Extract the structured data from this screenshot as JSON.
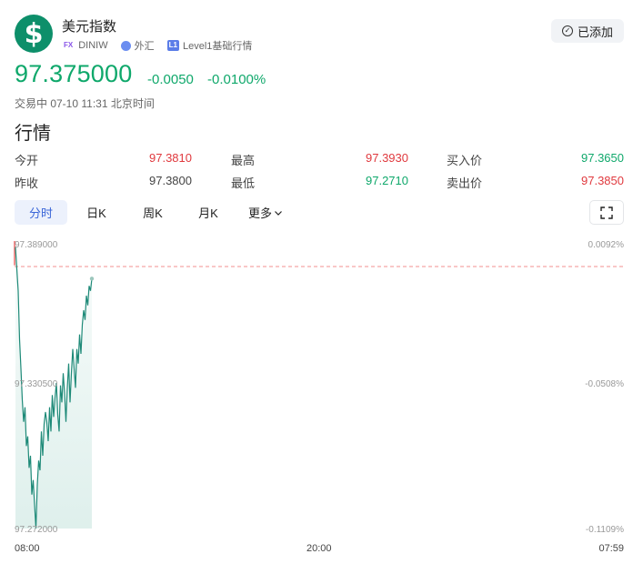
{
  "header": {
    "title": "美元指数",
    "logo_symbol": "$",
    "tag_fx": "FX",
    "code": "DINIW",
    "market": "外汇",
    "tag_level": "L1",
    "level_text": "Level1基础行情",
    "add_button": "已添加",
    "logo_color": "#0d8f6a"
  },
  "price": {
    "current": "97.375000",
    "change": "-0.0050",
    "change_pct": "-0.0100%",
    "status": "交易中 07-10 11:31 北京时间",
    "color": "#0fa86b"
  },
  "section_title": "行情",
  "quote": {
    "open_label": "今开",
    "open_value": "97.3810",
    "prev_close_label": "昨收",
    "prev_close_value": "97.3800",
    "high_label": "最高",
    "high_value": "97.3930",
    "low_label": "最低",
    "low_value": "97.2710",
    "bid_label": "买入价",
    "bid_value": "97.3650",
    "ask_label": "卖出价",
    "ask_value": "97.3850"
  },
  "tabs": [
    "分时",
    "日K",
    "周K",
    "月K",
    "更多"
  ],
  "active_tab": 0,
  "chart_data": {
    "type": "line",
    "ylim": [
      97.272,
      97.389
    ],
    "y_tick_labels": [
      "97.389000",
      "97.330500",
      "97.272000"
    ],
    "pct_tick_labels": [
      "0.0092%",
      "-0.0508%",
      "-0.1109%"
    ],
    "x_tick_labels": [
      "08:00",
      "20:00",
      "07:59"
    ],
    "reference_line": 97.38,
    "line_color": "#1e8a78",
    "reference_color": "#ef6b6b",
    "series": [
      {
        "points": [
          [
            0,
            97.388
          ],
          [
            1,
            97.379
          ],
          [
            2,
            97.37
          ],
          [
            3,
            97.35
          ],
          [
            4,
            97.338
          ],
          [
            5,
            97.325
          ],
          [
            6,
            97.316
          ],
          [
            7,
            97.322
          ],
          [
            8,
            97.306
          ],
          [
            9,
            97.31
          ],
          [
            10,
            97.297
          ],
          [
            11,
            97.302
          ],
          [
            12,
            97.286
          ],
          [
            13,
            97.292
          ],
          [
            14,
            97.282
          ],
          [
            15,
            97.272
          ],
          [
            16,
            97.29
          ],
          [
            17,
            97.3
          ],
          [
            18,
            97.296
          ],
          [
            19,
            97.312
          ],
          [
            20,
            97.302
          ],
          [
            21,
            97.315
          ],
          [
            22,
            97.32
          ],
          [
            23,
            97.316
          ],
          [
            24,
            97.308
          ],
          [
            25,
            97.322
          ],
          [
            26,
            97.312
          ],
          [
            27,
            97.327
          ],
          [
            28,
            97.318
          ],
          [
            29,
            97.326
          ],
          [
            30,
            97.332
          ],
          [
            31,
            97.319
          ],
          [
            32,
            97.312
          ],
          [
            33,
            97.331
          ],
          [
            34,
            97.324
          ],
          [
            35,
            97.336
          ],
          [
            36,
            97.328
          ],
          [
            37,
            97.316
          ],
          [
            38,
            97.33
          ],
          [
            39,
            97.34
          ],
          [
            40,
            97.324
          ],
          [
            41,
            97.336
          ],
          [
            42,
            97.346
          ],
          [
            43,
            97.338
          ],
          [
            44,
            97.33
          ],
          [
            45,
            97.346
          ],
          [
            46,
            97.34
          ],
          [
            47,
            97.352
          ],
          [
            48,
            97.344
          ],
          [
            49,
            97.356
          ],
          [
            50,
            97.362
          ],
          [
            51,
            97.358
          ],
          [
            52,
            97.368
          ],
          [
            53,
            97.364
          ],
          [
            54,
            97.372
          ],
          [
            55,
            97.37
          ],
          [
            56,
            97.375
          ]
        ]
      }
    ]
  }
}
